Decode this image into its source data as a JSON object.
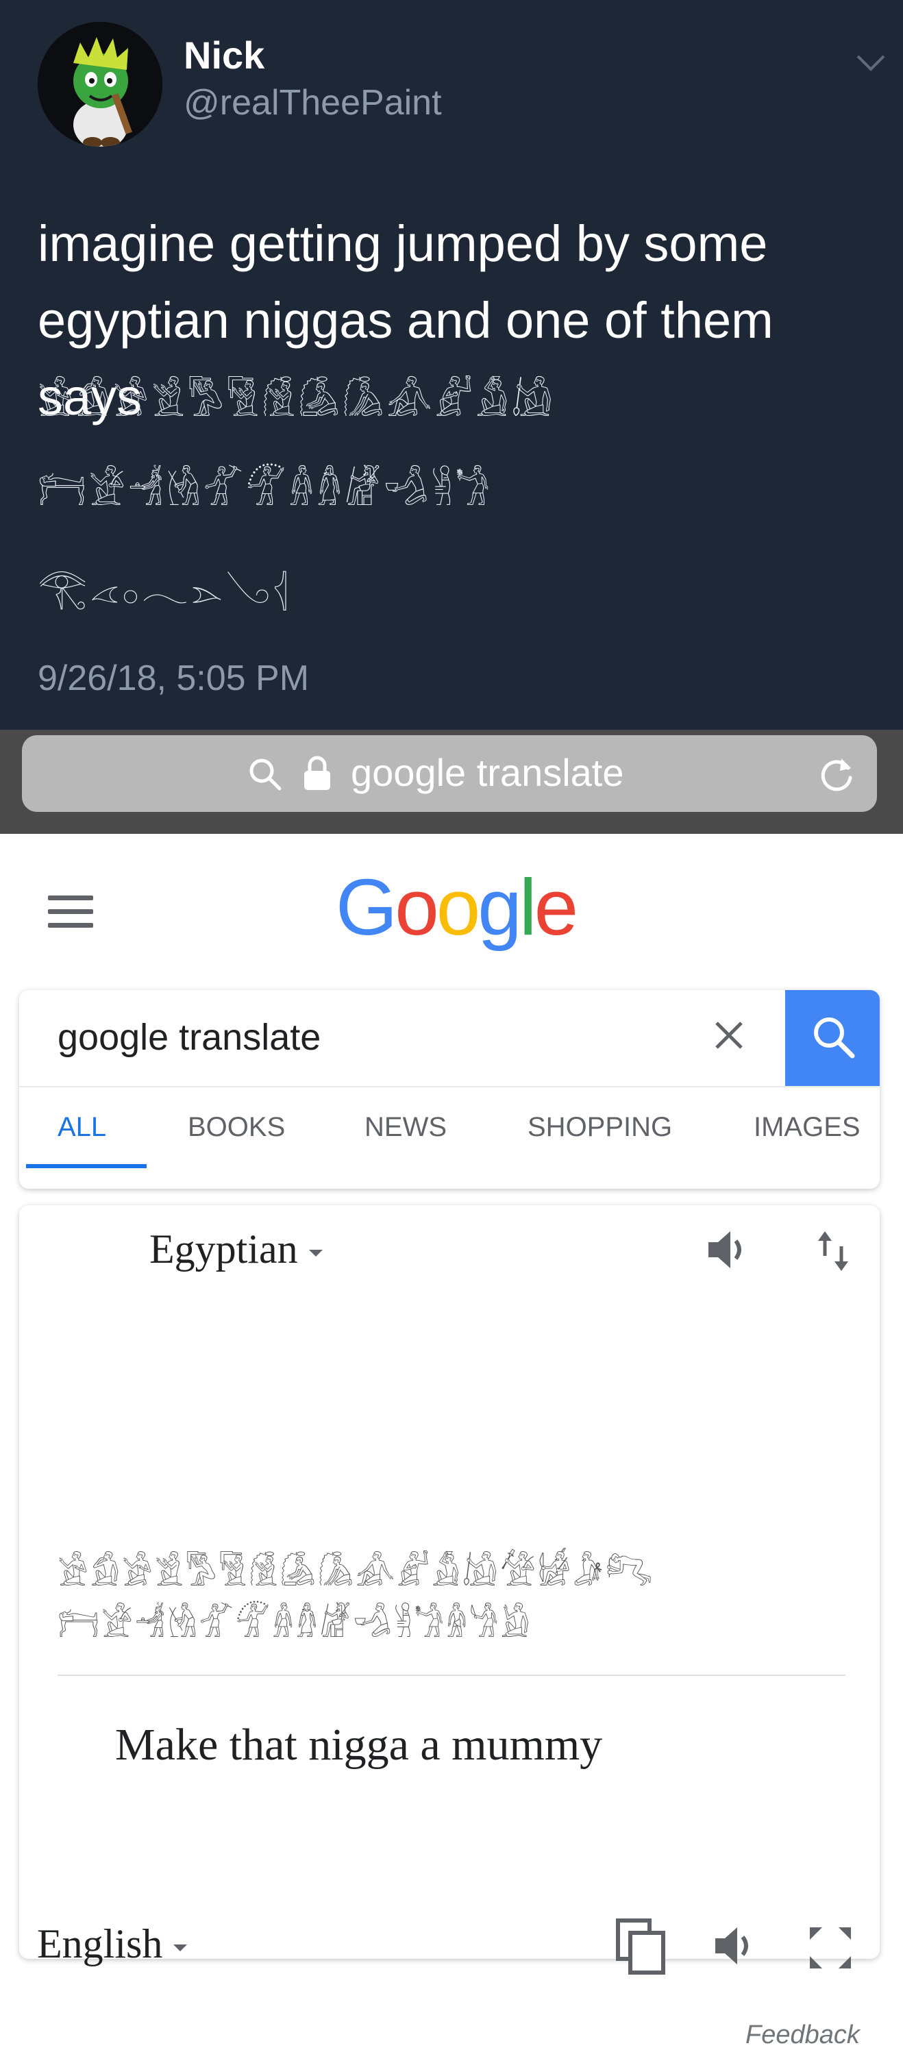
{
  "tweet": {
    "display_name": "Nick",
    "handle": "@realTheePaint",
    "text": "imagine getting jumped by some egyptian niggas and one of them says",
    "glyph_lines": [
      "𓀀𓀁𓀂𓀃𓀄𓀅𓀆𓀇𓀈𓀉𓀊𓀋𓀌",
      "𓁀𓁁𓁂𓁃𓁄𓁅𓁆𓁇𓁈𓁉𓁊𓁋",
      "𓂀𓂁𓂂𓂃𓂄𓂅𓂆"
    ],
    "timestamp": "9/26/18, 5:05 PM"
  },
  "browser": {
    "address_text": "google translate"
  },
  "google": {
    "logo_letters": [
      {
        "ch": "G",
        "color": "#4285f4"
      },
      {
        "ch": "o",
        "color": "#ea4335"
      },
      {
        "ch": "o",
        "color": "#fbbc05"
      },
      {
        "ch": "g",
        "color": "#4285f4"
      },
      {
        "ch": "l",
        "color": "#34a853"
      },
      {
        "ch": "e",
        "color": "#ea4335"
      }
    ],
    "search_query": "google translate",
    "tabs": [
      "ALL",
      "BOOKS",
      "NEWS",
      "SHOPPING",
      "IMAGES"
    ],
    "active_tab": "ALL"
  },
  "translate": {
    "source_language": "Egyptian",
    "source_glyph_lines": [
      "𓀀𓀁𓀂𓀃𓀄𓀅𓀆𓀇𓀈𓀉𓀊𓀋𓀌𓀍𓀎𓀏𓀐",
      "𓁀𓁁𓁂𓁃𓁄𓁅𓁆𓁇𓁈𓁉𓁊𓁋𓁌𓁍𓁎"
    ],
    "translation": "Make that nigga a mummy",
    "target_language": "English",
    "feedback": "Feedback"
  }
}
